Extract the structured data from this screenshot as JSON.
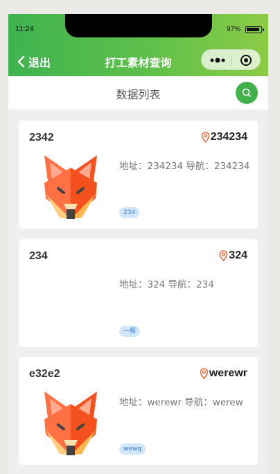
{
  "status": {
    "time": "11:24",
    "battery": "97%"
  },
  "nav": {
    "back_label": "退出",
    "title": "打工素材查询"
  },
  "subbar": {
    "title": "数据列表"
  },
  "cards": [
    {
      "name": "2342",
      "location": "234234",
      "address": "地址：234234 导航：234234",
      "tag": "234",
      "has_image": true
    },
    {
      "name": "234",
      "location": "324",
      "address": "地址：324 导航：234",
      "tag": "一般",
      "has_image": false
    },
    {
      "name": "e32e2",
      "location": "werewr",
      "address": "地址：werewr 导航：werew",
      "tag": "wewq",
      "has_image": true
    }
  ],
  "colors": {
    "accent": "#41b14b",
    "location_icon": "#e96a3a",
    "tag_bg": "#cfe6fb",
    "tag_text": "#3a7bd5"
  }
}
